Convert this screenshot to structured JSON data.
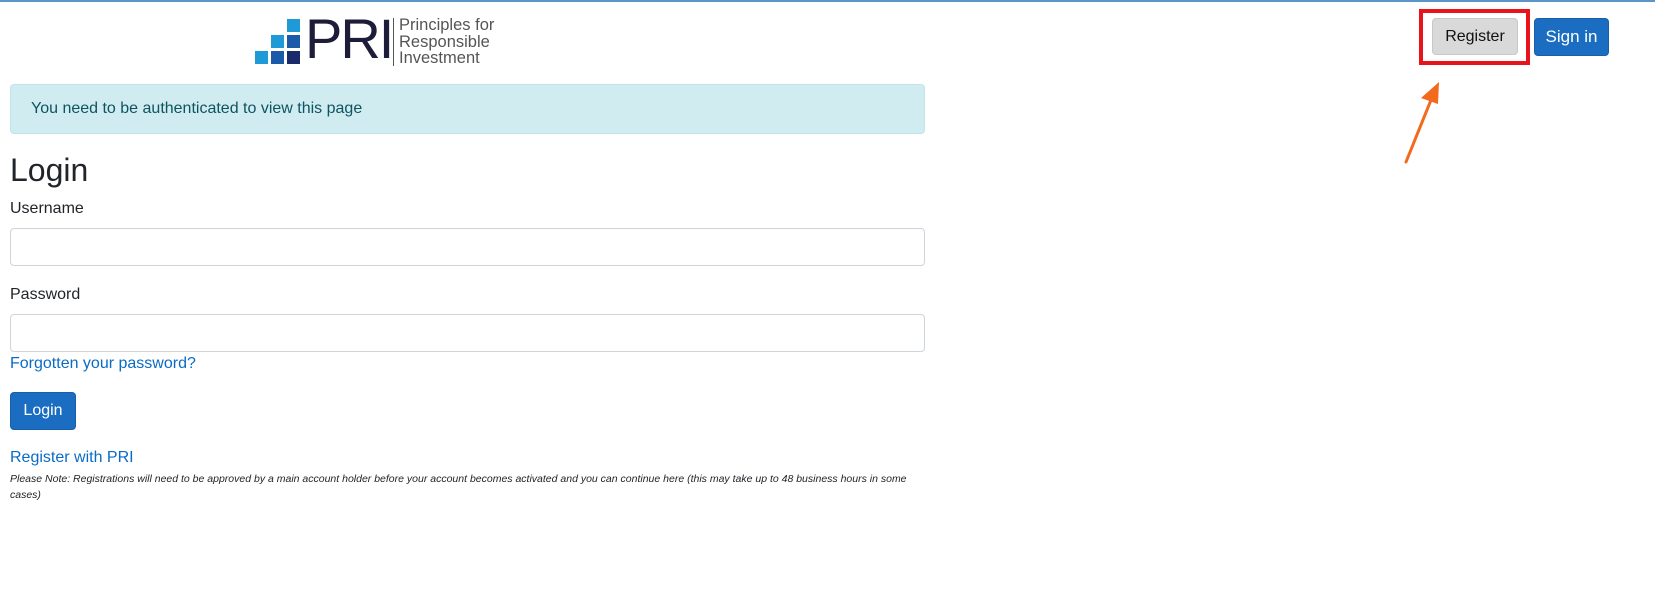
{
  "header": {
    "logo": {
      "wordmark": "PRI",
      "tagline_lines": [
        "Principles for",
        "Responsible",
        "Investment"
      ]
    },
    "register_label": "Register",
    "signin_label": "Sign in",
    "highlight_color": "#e8141c",
    "arrow_color": "#f26a1b"
  },
  "alert": {
    "message": "You need to be authenticated to view this page"
  },
  "login": {
    "title": "Login",
    "username_label": "Username",
    "username_value": "",
    "password_label": "Password",
    "password_value": "",
    "forgot_link": "Forgotten your password?",
    "submit_label": "Login",
    "register_link": "Register with PRI",
    "note": "Please Note: Registrations will need to be approved by a main account holder before your account becomes activated and you can continue here (this may take up to 48 business hours in some cases)"
  },
  "colors": {
    "primary": "#1b6dc1",
    "alert_bg": "#d1ecf1",
    "alert_text": "#0c5460",
    "link": "#0a6bc5"
  }
}
